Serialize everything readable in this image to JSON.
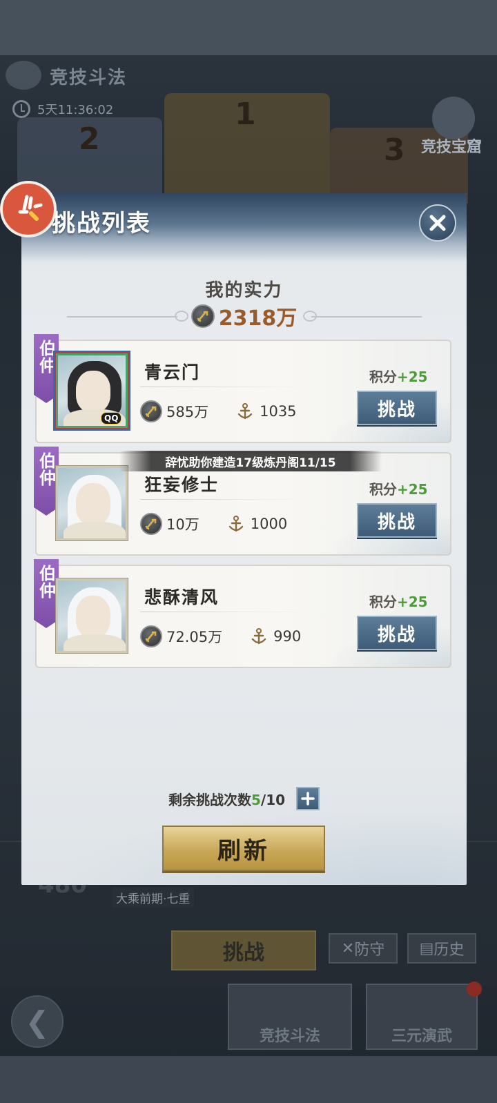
{
  "background": {
    "title": "竞技斗法",
    "timer": "5天11:36:02",
    "treasure_label": "竞技宝窟",
    "ranks": [
      "1",
      "2",
      "3"
    ],
    "score": "480",
    "realm": "大乘前期·七重",
    "challenge_label": "挑战",
    "defend_label": "防守",
    "history_label": "历史",
    "tabs": [
      "竞技斗法",
      "三元演武"
    ]
  },
  "modal": {
    "title": "挑战列表",
    "my_power_label": "我的实力",
    "my_power_value": "2318万",
    "remaining_label": "剩余挑战次数",
    "remaining_used": "5",
    "remaining_total": "/10",
    "refresh_label": "刷新",
    "challenge_label": "挑战",
    "score_label": "积分",
    "opponents": [
      {
        "rank_tag": "伯仲",
        "name": "青云门",
        "score_gain": "+25",
        "power": "585万",
        "honor": "1035",
        "badge": "QQ",
        "avatar_style": "dark-hair"
      },
      {
        "rank_tag": "伯仲",
        "name": "狂妄修士",
        "score_gain": "+25",
        "power": "10万",
        "honor": "1000",
        "avatar_style": "white-hair"
      },
      {
        "rank_tag": "伯仲",
        "name": "悲酥清风",
        "score_gain": "+25",
        "power": "72.05万",
        "honor": "990",
        "avatar_style": "white-hair"
      }
    ],
    "notification": "辞忧助你建造17级炼丹阁11/15"
  },
  "icons": {
    "close": "close-icon",
    "power": "sword-icon",
    "honor": "anchor-icon",
    "plus": "plus-icon",
    "corner": "app-badge-icon"
  },
  "colors": {
    "accent_green": "#4f9a3b",
    "power_orange": "#9b5a2a",
    "challenge_blue": "#3e5c78",
    "rank_purple": "#7d4ea8",
    "refresh_gold": "#c9a859"
  }
}
